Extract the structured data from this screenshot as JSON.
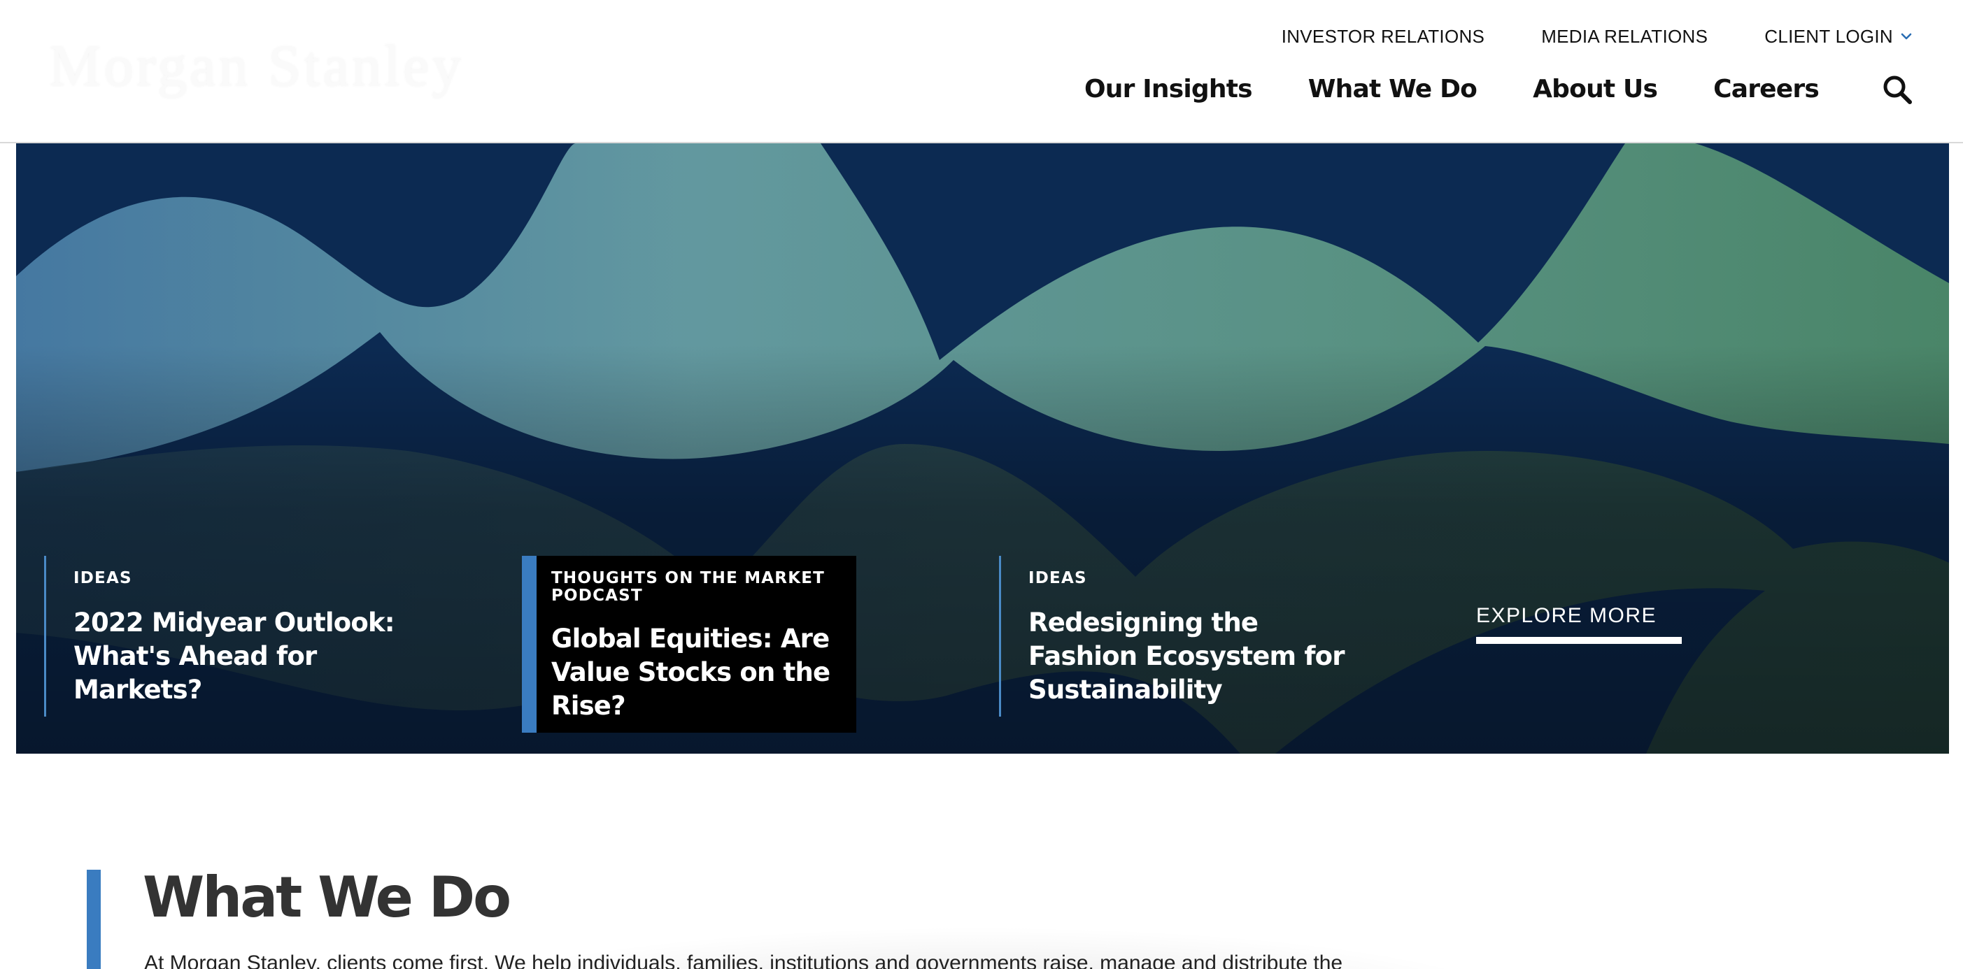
{
  "header": {
    "logo_text": "Morgan Stanley",
    "utility_nav": [
      {
        "label": "INVESTOR RELATIONS"
      },
      {
        "label": "MEDIA RELATIONS"
      },
      {
        "label": "CLIENT LOGIN",
        "icon": "chevron-down-icon"
      }
    ],
    "main_nav": [
      {
        "label": "Our Insights"
      },
      {
        "label": "What We Do"
      },
      {
        "label": "About Us"
      },
      {
        "label": "Careers"
      }
    ],
    "search_icon": "search-icon"
  },
  "hero": {
    "cards": [
      {
        "tag": "IDEAS",
        "title": "2022 Midyear Outlook: What's Ahead for Markets?"
      },
      {
        "tag": "THOUGHTS ON THE MARKET PODCAST",
        "title": "Global Equities: Are Value Stocks on the Rise?"
      },
      {
        "tag": "IDEAS",
        "title": "Redesigning the Fashion Ecosystem for Sustainability"
      }
    ],
    "explore_label": "EXPLORE MORE"
  },
  "section": {
    "title": "What We Do",
    "body": "At Morgan Stanley, clients come first. We help individuals, families, institutions and governments raise, manage and distribute the"
  },
  "colors": {
    "accent_blue": "#3a7cc0",
    "hero_navy": "#0c2a52",
    "wave_teal": "#6aa2a6",
    "wave_green": "#4f8d6a",
    "text_dark": "#333333"
  }
}
